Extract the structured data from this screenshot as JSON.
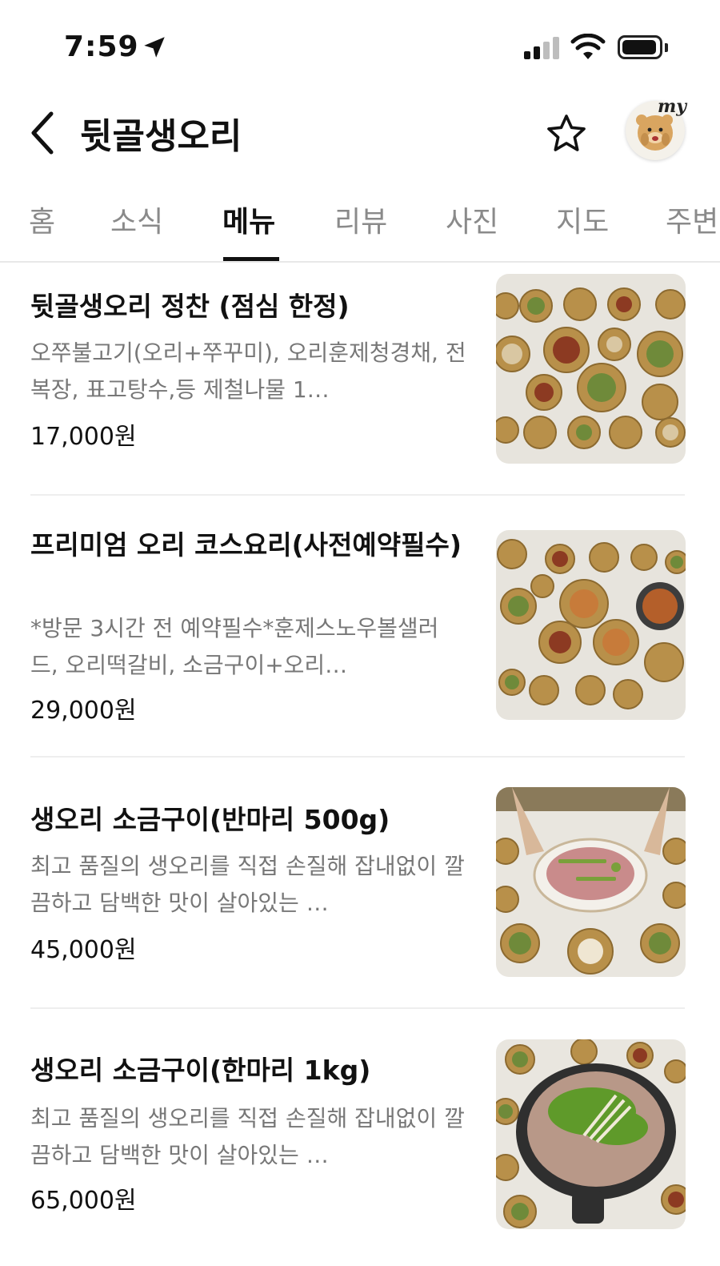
{
  "status": {
    "time": "7:59"
  },
  "header": {
    "title": "뒷골생오리",
    "avatar_text": "my"
  },
  "tabs": [
    {
      "label": "홈"
    },
    {
      "label": "소식"
    },
    {
      "label": "메뉴"
    },
    {
      "label": "리뷰"
    },
    {
      "label": "사진"
    },
    {
      "label": "지도"
    },
    {
      "label": "주변"
    }
  ],
  "active_tab": "메뉴",
  "menu": [
    {
      "name": "뒷골생오리 정찬 (점심 한정)",
      "desc": "오쭈불고기(오리+쭈꾸미), 오리훈제청경채, 전복장, 표고탕수,등 제철나물 1…",
      "price": "17,000원"
    },
    {
      "name": "프리미엄 오리 코스요리(사전예약필수)",
      "desc": "*방문 3시간 전 예약필수*훈제스노우볼샐러드, 오리떡갈비, 소금구이+오리…",
      "price": "29,000원"
    },
    {
      "name": "생오리 소금구이(반마리 500g)",
      "desc": "최고 품질의 생오리를 직접 손질해 잡내없이 깔끔하고 담백한 맛이 살아있는 …",
      "price": "45,000원"
    },
    {
      "name": "생오리 소금구이(한마리 1kg)",
      "desc": "최고 품질의 생오리를 직접 손질해 잡내없이 깔끔하고 담백한 맛이 살아있는 …",
      "price": "65,000원"
    }
  ],
  "colors": {
    "accent": "#111111",
    "inactive_tab": "#8a8a8a",
    "desc": "#777777",
    "tablecloth": "#e9e6df",
    "brass": "#b8904a"
  },
  "icons": {
    "back": "chevron-left-icon",
    "favorite": "star-outline-icon",
    "avatar": "bear-avatar-icon"
  }
}
